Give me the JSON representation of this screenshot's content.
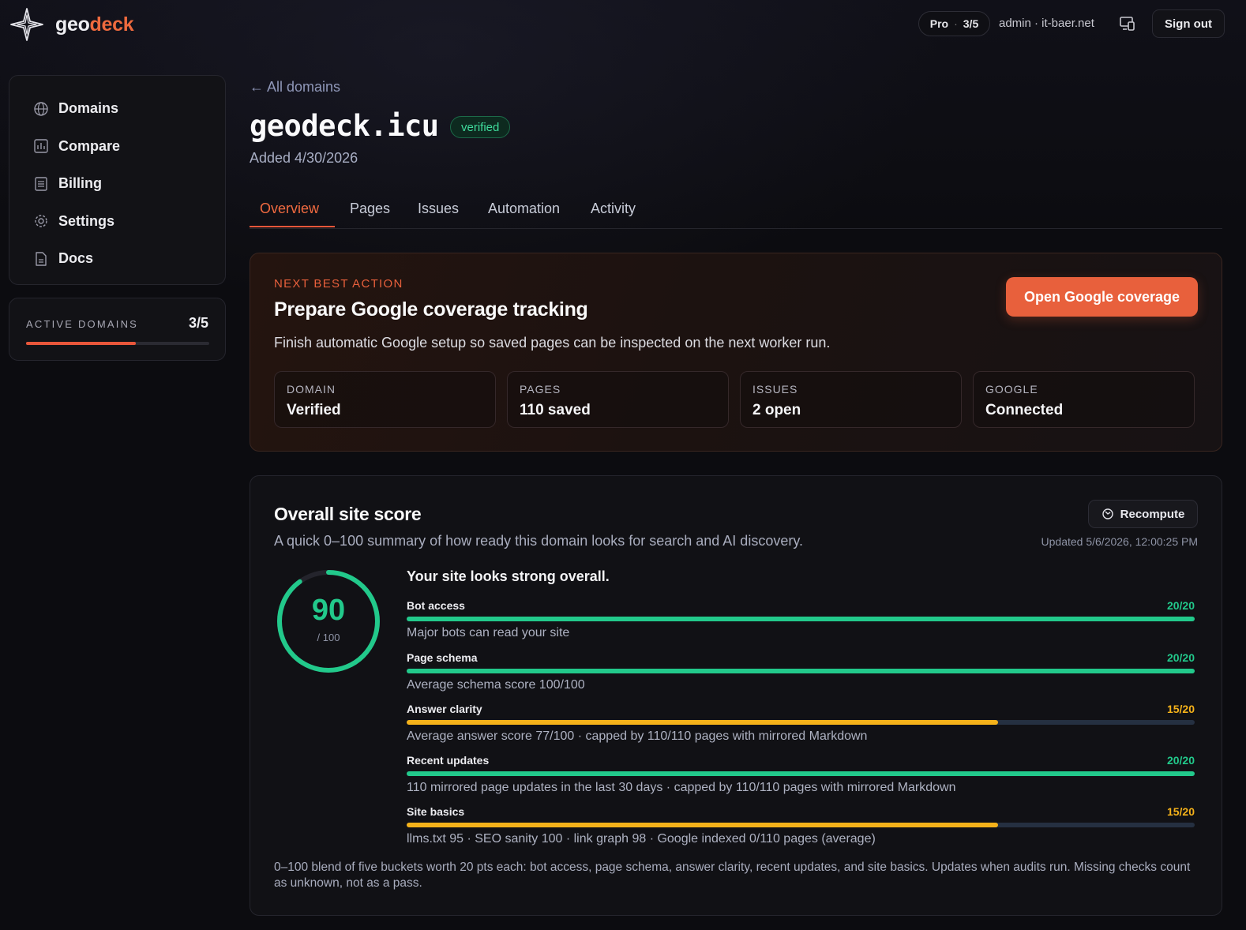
{
  "app": {
    "brand_a": "geo",
    "brand_b": "deck"
  },
  "topbar": {
    "plan": "Pro",
    "plan_sep": "·",
    "plan_usage": "3/5",
    "account": "admin · it-baer.net",
    "signout_label": "Sign out"
  },
  "sidebar": {
    "items": [
      {
        "label": "Domains",
        "icon": "globe-icon"
      },
      {
        "label": "Compare",
        "icon": "chart-icon"
      },
      {
        "label": "Billing",
        "icon": "receipt-icon"
      },
      {
        "label": "Settings",
        "icon": "gear-icon"
      },
      {
        "label": "Docs",
        "icon": "document-icon"
      }
    ],
    "active_domains": {
      "label": "ACTIVE DOMAINS",
      "value": "3/5",
      "fraction": 0.6
    }
  },
  "header": {
    "back_label": "← All domains",
    "domain": "geodeck.icu",
    "badge": "verified",
    "added": "Added 4/30/2026"
  },
  "tabs": [
    "Overview",
    "Pages",
    "Issues",
    "Automation",
    "Activity"
  ],
  "active_tab": "Overview",
  "next_best_action": {
    "kicker": "NEXT BEST ACTION",
    "title": "Prepare Google coverage tracking",
    "description": "Finish automatic Google setup so saved pages can be inspected on the next worker run.",
    "cta_label": "Open Google coverage",
    "stats": [
      {
        "label": "DOMAIN",
        "value": "Verified"
      },
      {
        "label": "PAGES",
        "value": "110 saved"
      },
      {
        "label": "ISSUES",
        "value": "2 open"
      },
      {
        "label": "GOOGLE",
        "value": "Connected"
      }
    ]
  },
  "score": {
    "title": "Overall site score",
    "description": "A quick 0–100 summary of how ready this domain looks for search and AI discovery.",
    "recompute_label": "Recompute",
    "updated": "Updated 5/6/2026, 12:00:25 PM",
    "value": "90",
    "denominator": "/ 100",
    "value_fraction": 0.9,
    "summary": "Your site looks strong overall.",
    "buckets": [
      {
        "name": "Bot access",
        "points": "20/20",
        "fraction": 1.0,
        "note": "Major bots can read your site"
      },
      {
        "name": "Page schema",
        "points": "20/20",
        "fraction": 1.0,
        "note": "Average schema score 100/100"
      },
      {
        "name": "Answer clarity",
        "points": "15/20",
        "fraction": 0.75,
        "note": "Average answer score 77/100 · capped by 110/110 pages with mirrored Markdown"
      },
      {
        "name": "Recent updates",
        "points": "20/20",
        "fraction": 1.0,
        "note": "110 mirrored page updates in the last 30 days · capped by 110/110 pages with mirrored Markdown"
      },
      {
        "name": "Site basics",
        "points": "15/20",
        "fraction": 0.75,
        "note": "llms.txt 95 · SEO sanity 100 · link graph 98 · Google indexed 0/110 pages (average)"
      }
    ],
    "footnote": "0–100 blend of five buckets worth 20 pts each: bot access, page schema, answer clarity, recent updates, and site basics. Updates when audits run. Missing checks count as unknown, not as a pass."
  },
  "colors": {
    "accent": "#e8603c",
    "good": "#22c98b",
    "warn": "#f5b21a",
    "track": "#253041"
  }
}
